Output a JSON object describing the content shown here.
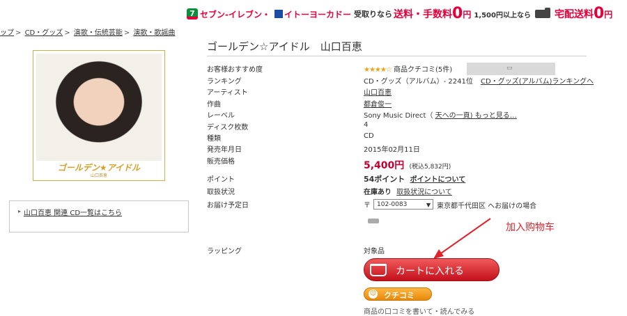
{
  "banner": {
    "logo_7": "7",
    "seven": "セブン-イレブン・",
    "ito": "イトーヨーカドー",
    "pickup_text": "受取りなら",
    "pickup_free": "送料・手数料",
    "zero1": "0",
    "yen1": "円",
    "threshold": "1,500円以上なら",
    "delivery_free": "宅配送料",
    "zero2": "0",
    "yen2": "円"
  },
  "breadcrumb": [
    "ップ",
    "CD・グッズ",
    "演歌・伝統芸能",
    "演歌・歌謡曲"
  ],
  "cover": {
    "title": "ゴールデン★アイドル",
    "artist": "山口百恵"
  },
  "related_link": "山口百恵 関連 CD一覧はこちら",
  "product": {
    "title": "ゴールデン☆アイドル　山口百恵",
    "rows": [
      {
        "label": "お客様おすすめ度",
        "value": ""
      },
      {
        "label": "ランキング",
        "value": "CD・グッズ（アルバム）- 2241位"
      },
      {
        "label": "アーティスト",
        "value": "山口百恵"
      },
      {
        "label": "作曲",
        "value": "都倉俊一"
      },
      {
        "label": "レーベル",
        "value": "Sony Music Direct（"
      },
      {
        "label": "ディスク枚数",
        "value": "4"
      },
      {
        "label": "種類",
        "value": "CD"
      },
      {
        "label": "発売年月日",
        "value": "2015年02月11日"
      },
      {
        "label": "販売価格",
        "value": ""
      },
      {
        "label": "ポイント",
        "value": ""
      },
      {
        "label": "取扱状況",
        "value": ""
      },
      {
        "label": "お届け予定日",
        "value": ""
      },
      {
        "label": "ラッピング",
        "value": "対象品"
      }
    ],
    "stars": "★★★★☆",
    "review_label": "商品クチコミ(5件)",
    "ranking_link": "CD・グッズ(アルバム)ランキングへ",
    "label_link_extra": "天への一頁)  もっと見る…",
    "price": "5,400円",
    "price_tax": "(税込5,832円)",
    "points": "54ポイント",
    "points_link": "ポイントについて",
    "stock": "在庫あり",
    "stock_link": "取扱状況について",
    "delivery_prefix": "〒",
    "postal": "102-0083",
    "delivery_text": "東京都千代田区 へお届けの場合"
  },
  "annotation": "加入购物车",
  "cart_button": "カートに入れる",
  "kuchikomi_button": "クチコミ",
  "cut_line": "商品の口コミを書いて・読んでみる"
}
